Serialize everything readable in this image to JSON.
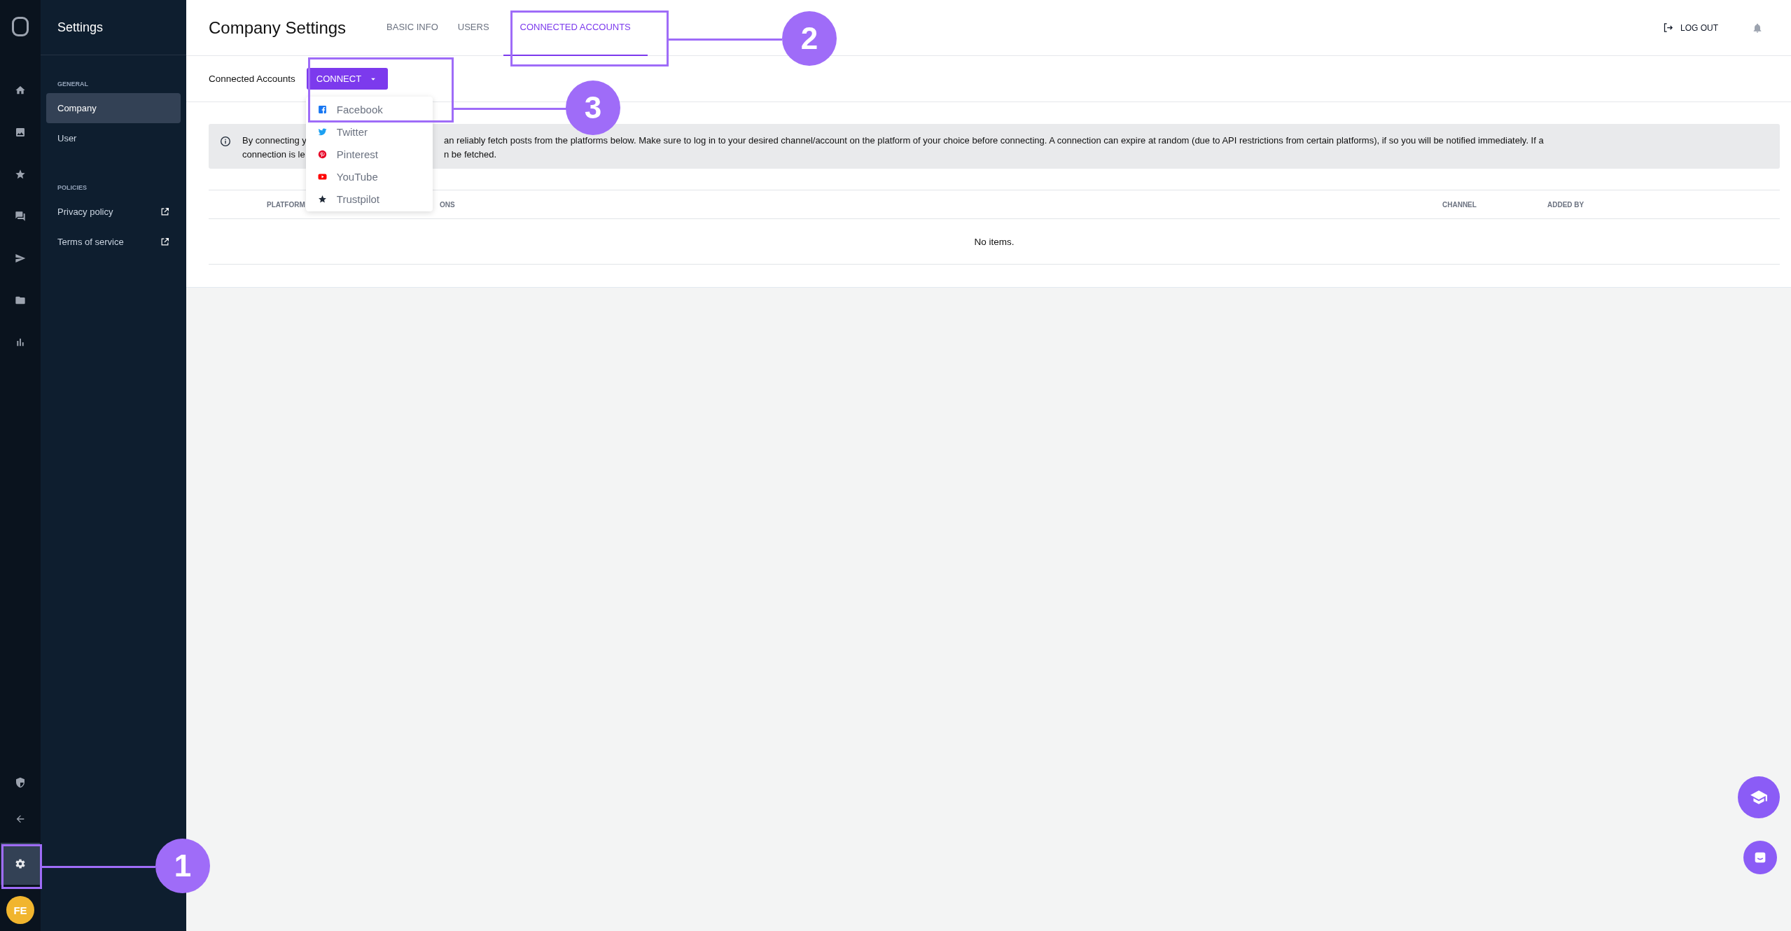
{
  "rail": {
    "top": [
      {
        "kind": "home",
        "selected": false
      },
      {
        "kind": "image",
        "selected": false
      },
      {
        "kind": "star",
        "selected": false
      },
      {
        "kind": "chat",
        "selected": false
      },
      {
        "kind": "send",
        "selected": false
      },
      {
        "kind": "folder",
        "selected": false
      },
      {
        "kind": "chart",
        "selected": false
      }
    ],
    "bottom": [
      {
        "kind": "shield",
        "selected": false
      },
      {
        "kind": "back",
        "selected": false
      },
      {
        "kind": "gear",
        "selected": true
      }
    ],
    "avatar": "FE"
  },
  "sidebar": {
    "title": "Settings",
    "sections": [
      {
        "heading": "GENERAL",
        "items": [
          {
            "label": "Company",
            "selected": true,
            "external": false
          },
          {
            "label": "User",
            "selected": false,
            "external": false
          }
        ]
      },
      {
        "heading": "POLICIES",
        "items": [
          {
            "label": "Privacy policy",
            "selected": false,
            "external": true
          },
          {
            "label": "Terms of service",
            "selected": false,
            "external": true
          }
        ]
      }
    ]
  },
  "header": {
    "title": "Company Settings",
    "tabs": [
      {
        "label": "BASIC INFO",
        "selected": false
      },
      {
        "label": "USERS",
        "selected": false
      },
      {
        "label": "CONNECTED ACCOUNTS",
        "selected": true
      }
    ],
    "logout": "LOG OUT"
  },
  "toolbar": {
    "label": "Connected Accounts",
    "button": "CONNECT",
    "menu": [
      {
        "kind": "facebook",
        "label": "Facebook"
      },
      {
        "kind": "twitter",
        "label": "Twitter"
      },
      {
        "kind": "pinterest",
        "label": "Pinterest"
      },
      {
        "kind": "youtube",
        "label": "YouTube"
      },
      {
        "kind": "trustpilot",
        "label": "Trustpilot"
      }
    ]
  },
  "info": {
    "lines": [
      {
        "start": "By connecting y",
        "end": "an reliably fetch posts from the platforms below. Make sure to log in to your desired channel/account on the platform of your choice before connecting. A connection can expire at random (due to API restrictions from certain platforms), if so you will be notified immediately. If a"
      },
      {
        "start": "connection is le",
        "end": "n be fetched."
      }
    ]
  },
  "table": {
    "columns": [
      {
        "label": "PLATFORM"
      },
      {
        "label": "ONS"
      },
      {
        "label": "CHANNEL"
      },
      {
        "label": "ADDED BY"
      }
    ],
    "empty": "No items."
  },
  "annotations": [
    {
      "label": "1"
    },
    {
      "label": "2"
    },
    {
      "label": "3"
    }
  ]
}
